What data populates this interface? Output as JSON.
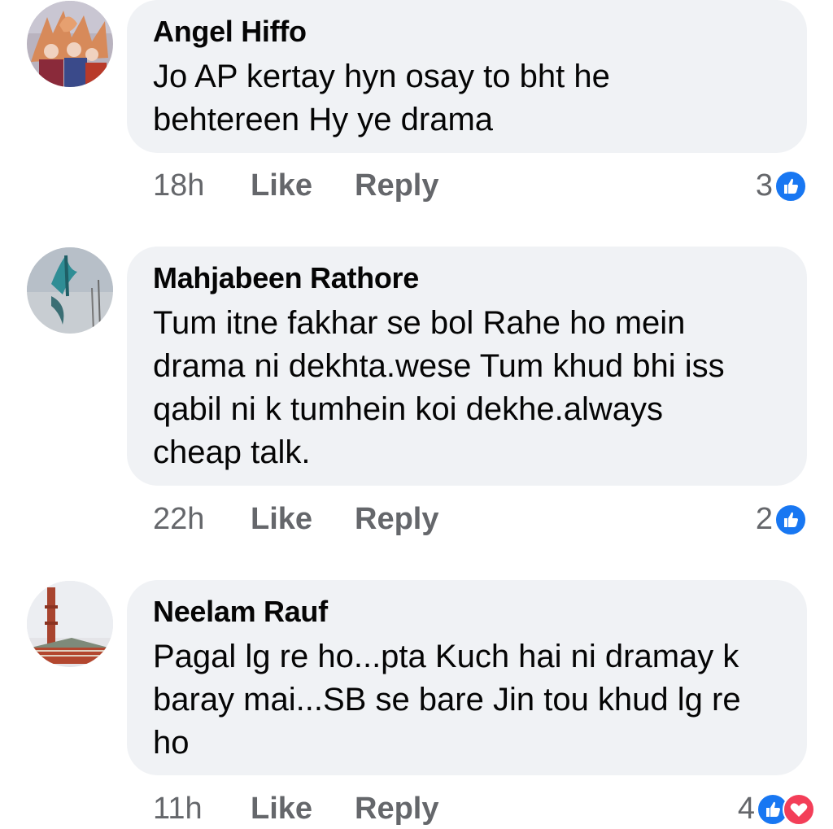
{
  "comments": [
    {
      "author": "Angel Hiffo",
      "text": "Jo AP kertay hyn osay to bht he\nbehtereen Hy ye drama",
      "time": "18h",
      "like_label": "Like",
      "reply_label": "Reply",
      "reaction_count": "3"
    },
    {
      "author": "Mahjabeen Rathore",
      "text": "Tum itne fakhar se bol Rahe ho mein\ndrama ni dekhta.wese Tum khud bhi iss\nqabil ni k tumhein koi dekhe.always\ncheap talk.",
      "time": "22h",
      "like_label": "Like",
      "reply_label": "Reply",
      "reaction_count": "2"
    },
    {
      "author": "Neelam Rauf",
      "text": "Pagal lg re ho...pta Kuch hai ni dramay k\nbaray mai...SB se bare Jin tou khud lg re\nho",
      "time": "11h",
      "like_label": "Like",
      "reply_label": "Reply",
      "reaction_count": "4"
    }
  ],
  "colors": {
    "bubble": "#f0f2f5",
    "meta_text": "#65676b",
    "like_blue": "#1877f2",
    "love_red": "#f33e58"
  },
  "icons": [
    "like-reaction-icon",
    "love-reaction-icon"
  ]
}
